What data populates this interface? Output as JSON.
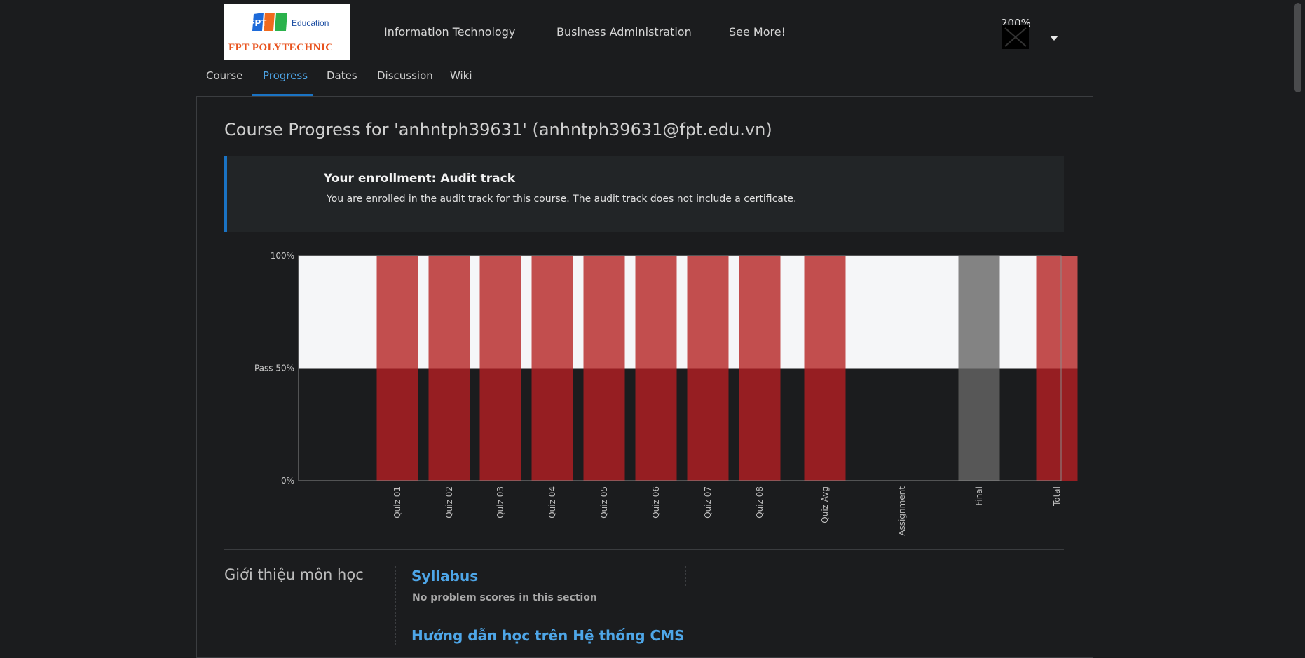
{
  "header": {
    "logo": {
      "top_text": "FPT",
      "edu_text": "Education",
      "bottom_text": "FPT POLYTECHNIC"
    },
    "nav": [
      "Information Technology",
      "Business Administration",
      "See More!"
    ],
    "zoom_label": "200%"
  },
  "course_nav": {
    "tabs": [
      "Course",
      "Progress",
      "Dates",
      "Discussion",
      "Wiki"
    ],
    "active": "Progress"
  },
  "page": {
    "title": "Course Progress for 'anhntph39631' (anhntph39631@fpt.edu.vn)"
  },
  "enrollment": {
    "title": "Your enrollment: Audit track",
    "text": "You are enrolled in the audit track for this course. The audit track does not include a certificate."
  },
  "chart_data": {
    "type": "bar",
    "categories": [
      "Quiz 01",
      "Quiz 02",
      "Quiz 03",
      "Quiz 04",
      "Quiz 05",
      "Quiz 06",
      "Quiz 07",
      "Quiz 08",
      "Quiz Avg",
      "Assignment",
      "Final",
      "Total"
    ],
    "values": [
      100,
      100,
      100,
      100,
      100,
      100,
      100,
      100,
      100,
      0,
      100,
      100
    ],
    "bar_colors": [
      "#c24e4e",
      "#c24e4e",
      "#c24e4e",
      "#c24e4e",
      "#c24e4e",
      "#c24e4e",
      "#c24e4e",
      "#c24e4e",
      "#c24e4e",
      "#c24e4e",
      "#838383",
      "#c24e4e"
    ],
    "bar_colors_below_pass": [
      "#961e22",
      "#961e22",
      "#961e22",
      "#961e22",
      "#961e22",
      "#961e22",
      "#961e22",
      "#961e22",
      "#961e22",
      "#961e22",
      "#575757",
      "#961e22"
    ],
    "ytick_labels": [
      "100%",
      "Pass 50%",
      "0%"
    ],
    "yticks": [
      100,
      50,
      0
    ],
    "ylim": [
      0,
      100
    ],
    "pass_threshold": 50,
    "colors": {
      "above_pass_bg": "#f5f6f8",
      "below_pass_bg": "#1b1c1e"
    }
  },
  "sections": [
    {
      "title": "Giới thiệu môn học",
      "subsections": [
        {
          "title": "Syllabus",
          "status": "No problem scores in this section"
        },
        {
          "title": "Hướng dẫn học trên Hệ thống CMS"
        }
      ]
    }
  ]
}
